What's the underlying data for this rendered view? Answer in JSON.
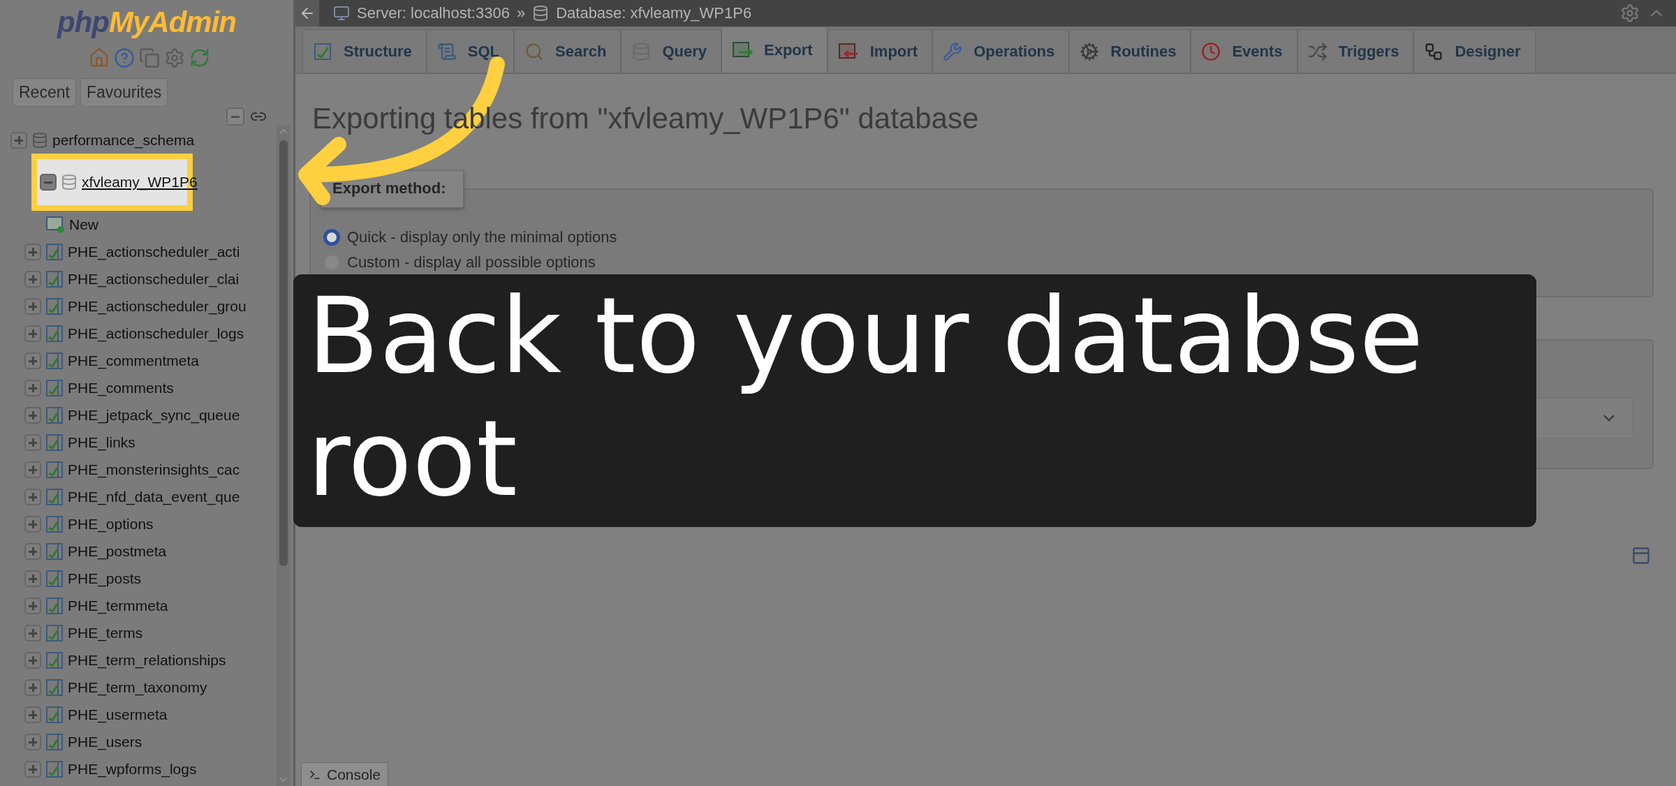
{
  "sidebar": {
    "logo": {
      "php": "php",
      "rest": "MyAdmin"
    },
    "buttons": [
      {
        "label": "Recent"
      },
      {
        "label": "Favourites"
      }
    ],
    "tree": [
      {
        "kind": "database",
        "label": "performance_schema",
        "expanded": false,
        "selected": false
      },
      {
        "kind": "database",
        "label": "xfvleamy_WP1P6",
        "expanded": true,
        "selected": true,
        "children": [
          {
            "kind": "new",
            "label": "New"
          },
          {
            "kind": "table",
            "label": "PHE_actionscheduler_acti",
            "expanded": false
          },
          {
            "kind": "table",
            "label": "PHE_actionscheduler_clai",
            "expanded": false
          },
          {
            "kind": "table",
            "label": "PHE_actionscheduler_grou",
            "expanded": false
          },
          {
            "kind": "table",
            "label": "PHE_actionscheduler_logs",
            "expanded": false
          },
          {
            "kind": "table",
            "label": "PHE_commentmeta",
            "expanded": false
          },
          {
            "kind": "table",
            "label": "PHE_comments",
            "expanded": false
          },
          {
            "kind": "table",
            "label": "PHE_jetpack_sync_queue",
            "expanded": false
          },
          {
            "kind": "table",
            "label": "PHE_links",
            "expanded": false
          },
          {
            "kind": "table",
            "label": "PHE_monsterinsights_cac",
            "expanded": false
          },
          {
            "kind": "table",
            "label": "PHE_nfd_data_event_que",
            "expanded": false
          },
          {
            "kind": "table",
            "label": "PHE_options",
            "expanded": false
          },
          {
            "kind": "table",
            "label": "PHE_postmeta",
            "expanded": false
          },
          {
            "kind": "table",
            "label": "PHE_posts",
            "expanded": false
          },
          {
            "kind": "table",
            "label": "PHE_termmeta",
            "expanded": false
          },
          {
            "kind": "table",
            "label": "PHE_terms",
            "expanded": false
          },
          {
            "kind": "table",
            "label": "PHE_term_relationships",
            "expanded": false
          },
          {
            "kind": "table",
            "label": "PHE_term_taxonomy",
            "expanded": false
          },
          {
            "kind": "table",
            "label": "PHE_usermeta",
            "expanded": false
          },
          {
            "kind": "table",
            "label": "PHE_users",
            "expanded": false
          },
          {
            "kind": "table",
            "label": "PHE_wpforms_logs",
            "expanded": false
          }
        ]
      }
    ]
  },
  "breadcrumb": {
    "server": "Server: localhost:3306",
    "separator": "»",
    "database": "Database: xfvleamy_WP1P6"
  },
  "tabs": [
    {
      "label": "Structure",
      "selected": false
    },
    {
      "label": "SQL",
      "selected": false
    },
    {
      "label": "Search",
      "selected": false
    },
    {
      "label": "Query",
      "selected": false
    },
    {
      "label": "Export",
      "selected": true
    },
    {
      "label": "Import",
      "selected": false
    },
    {
      "label": "Operations",
      "selected": false
    },
    {
      "label": "Routines",
      "selected": false
    },
    {
      "label": "Events",
      "selected": false
    },
    {
      "label": "Triggers",
      "selected": false
    },
    {
      "label": "Designer",
      "selected": false
    }
  ],
  "heading": "Exporting tables from \"xfvleamy_WP1P6\" database",
  "export_method": {
    "legend": "Export method:",
    "options": [
      {
        "label": "Quick - display only the minimal options",
        "selected": true
      },
      {
        "label": "Custom - display all possible options",
        "selected": false
      }
    ]
  },
  "console": {
    "label": "Console"
  },
  "caption": "Back to your databse root"
}
